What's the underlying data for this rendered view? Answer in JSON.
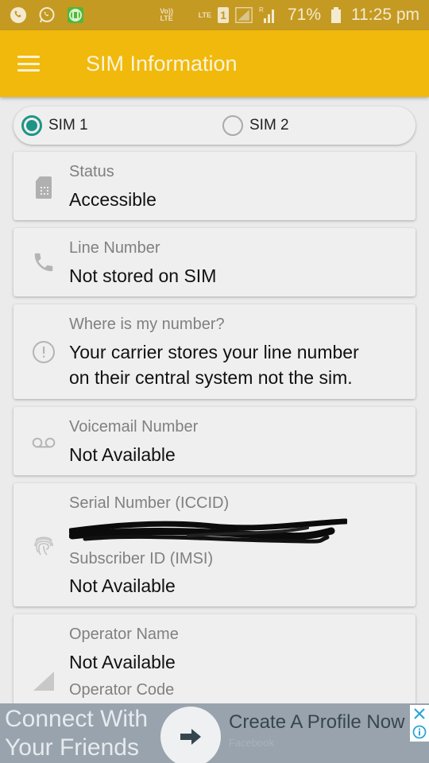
{
  "status_bar": {
    "icons_left": [
      "phone-icon",
      "whatsapp-icon",
      "app-notification-icon"
    ],
    "volte_label": "Vo)) LTE",
    "lte_label": "LTE",
    "sim_slot": "1",
    "roaming_label": "R",
    "battery_percent": "71%",
    "time": "11:25 pm"
  },
  "app_bar": {
    "title": "SIM Information",
    "menu_icon": "hamburger-menu-icon",
    "color": "#f0b90b"
  },
  "sim_selector": {
    "options": [
      {
        "label": "SIM 1",
        "selected": true
      },
      {
        "label": "SIM 2",
        "selected": false
      }
    ],
    "accent": "#1f9486"
  },
  "cards": {
    "status": {
      "icon": "sim-card-icon",
      "label": "Status",
      "value": "Accessible"
    },
    "line_number": {
      "icon": "phone-icon",
      "label": "Line Number",
      "value": "Not stored on SIM"
    },
    "where_number": {
      "icon": "info-exclamation-icon",
      "label": "Where is my number?",
      "value_line1": "Your carrier stores your line number",
      "value_line2": "on their central system not the sim."
    },
    "voicemail": {
      "icon": "voicemail-icon",
      "label": "Voicemail Number",
      "value": "Not Available"
    },
    "serial": {
      "icon": "fingerprint-icon",
      "label": "Serial Number (ICCID)",
      "value": "[redacted]",
      "label2": "Subscriber ID (IMSI)",
      "value2": "Not Available"
    },
    "operator": {
      "icon": "signal-icon",
      "label": "Operator Name",
      "value": "Not Available",
      "label2": "Operator Code"
    }
  },
  "ad": {
    "headline_line1": "Connect With",
    "headline_line2": "Your Friends",
    "cta": "Create A Profile Now",
    "brand": "Facebook",
    "close_icon": "close-icon",
    "info_icon": "info-icon"
  }
}
